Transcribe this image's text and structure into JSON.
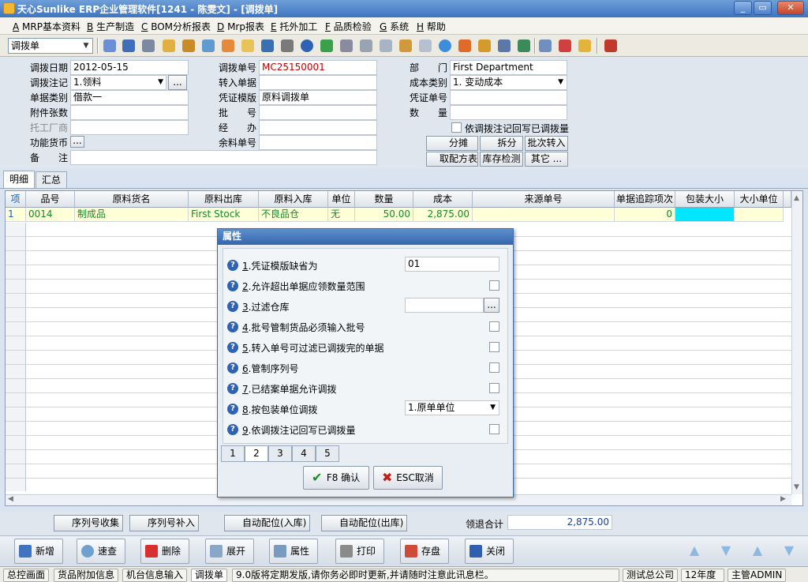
{
  "window": {
    "title": "天心Sunlike ERP企业管理软件[1241 - 陈雯文] - [调拨单]"
  },
  "menu": [
    {
      "key": "A",
      "label": "MRP基本资料"
    },
    {
      "key": "B",
      "label": "生产制造"
    },
    {
      "key": "C",
      "label": "BOM分析报表"
    },
    {
      "key": "D",
      "label": "Mrp报表"
    },
    {
      "key": "E",
      "label": "托外加工"
    },
    {
      "key": "F",
      "label": "品质检验"
    },
    {
      "key": "G",
      "label": "系统"
    },
    {
      "key": "H",
      "label": "帮助"
    }
  ],
  "toolbar": {
    "doc_type": "调拨单"
  },
  "form": {
    "date_label": "调拨日期",
    "date_value": "2012-05-15",
    "note_label": "调拨注记",
    "note_value": "1.领料",
    "note_btn": "...",
    "doctype_label": "单据类别",
    "doctype_value": "借款一",
    "attach_label": "附件张数",
    "attach_value": "",
    "vendor_label": "托工厂商",
    "vendor_value": "",
    "currency_label": "功能货币",
    "currency_btn": "...",
    "remark_label": "备　　注",
    "remark_value": "",
    "no_label": "调拨单号",
    "no_value": "MC25150001",
    "in_label": "转入单据",
    "in_value": "",
    "tpl_label": "凭证模版",
    "tpl_value": "原料调拨单",
    "batch_label": "批　　号",
    "batch_value": "",
    "handler_label": "经　　办",
    "handler_value": "",
    "rest_label": "余料单号",
    "rest_value": "",
    "dept_label": "部　　门",
    "dept_value": "First Department",
    "cost_label": "成本类别",
    "cost_value": "1. 变动成本",
    "voucher_label": "凭证单号",
    "voucher_value": "",
    "qty_label": "数　　量",
    "qty_value": "",
    "writeback_label": "依调拨注记回写已调拨量",
    "btn_split": "分摊",
    "btn_apart": "拆分",
    "btn_batch_in": "批次转入",
    "btn_recipe": "取配方表",
    "btn_stock": "库存检测",
    "btn_other": "其它 ..."
  },
  "tabs": [
    "明细",
    "汇总"
  ],
  "grid": {
    "headers": [
      "项",
      "品号",
      "原料货名",
      "原料出库",
      "原料入库",
      "单位",
      "数量",
      "成本",
      "来源单号",
      "单据追踪项次",
      "包装大小",
      "大小单位"
    ],
    "rows": [
      {
        "item": "1",
        "code": "0014",
        "name": "制成品",
        "out": "First Stock",
        "in": "不良品仓",
        "unit": "无",
        "qty": "50.00",
        "cost": "2,875.00",
        "src": "",
        "track": "0",
        "pack": "",
        "packunit": ""
      }
    ]
  },
  "dialog": {
    "title": "属性",
    "props": [
      {
        "num": "1",
        "label": ".凭证模版缺省为",
        "value": "01",
        "kind": "text"
      },
      {
        "num": "2",
        "label": ".允许超出单据应领数量范围",
        "kind": "check"
      },
      {
        "num": "3",
        "label": ".过滤仓库",
        "value": "",
        "kind": "lookup"
      },
      {
        "num": "4",
        "label": ".批号管制货品必须输入批号",
        "kind": "check"
      },
      {
        "num": "5",
        "label": ".转入单号可过滤已调拨完的单据",
        "kind": "check"
      },
      {
        "num": "6",
        "label": ".管制序列号",
        "kind": "check"
      },
      {
        "num": "7",
        "label": ".已结案单据允许调拨",
        "kind": "check"
      },
      {
        "num": "8",
        "label": ".按包装单位调拨",
        "value": "1.原单单位",
        "kind": "select"
      },
      {
        "num": "9",
        "label": ".依调拨注记回写已调拨量",
        "kind": "check"
      }
    ],
    "pages": [
      "1",
      "2",
      "3",
      "4",
      "5"
    ],
    "active_page": "2",
    "ok_label": "F8 确认",
    "cancel_label": "ESC取消"
  },
  "seqbar": {
    "collect": "序列号收集",
    "supplement": "序列号补入",
    "auto_in": "自动配位(入库)",
    "auto_out": "自动配位(出库)",
    "total_label": "领退合计",
    "total_value": "2,875.00"
  },
  "actions": [
    "新增",
    "速查",
    "删除",
    "展开",
    "属性",
    "打印",
    "存盘",
    "关闭"
  ],
  "statusbar": {
    "tabs": [
      "总控画面",
      "货品附加信息",
      "机台信息输入",
      "调拨单"
    ],
    "message": "9.0版将定期发版,请你务必即时更新,并请随时注意此讯息栏。",
    "company": "测试总公司",
    "year": "12年度",
    "user": "主管ADMIN"
  }
}
